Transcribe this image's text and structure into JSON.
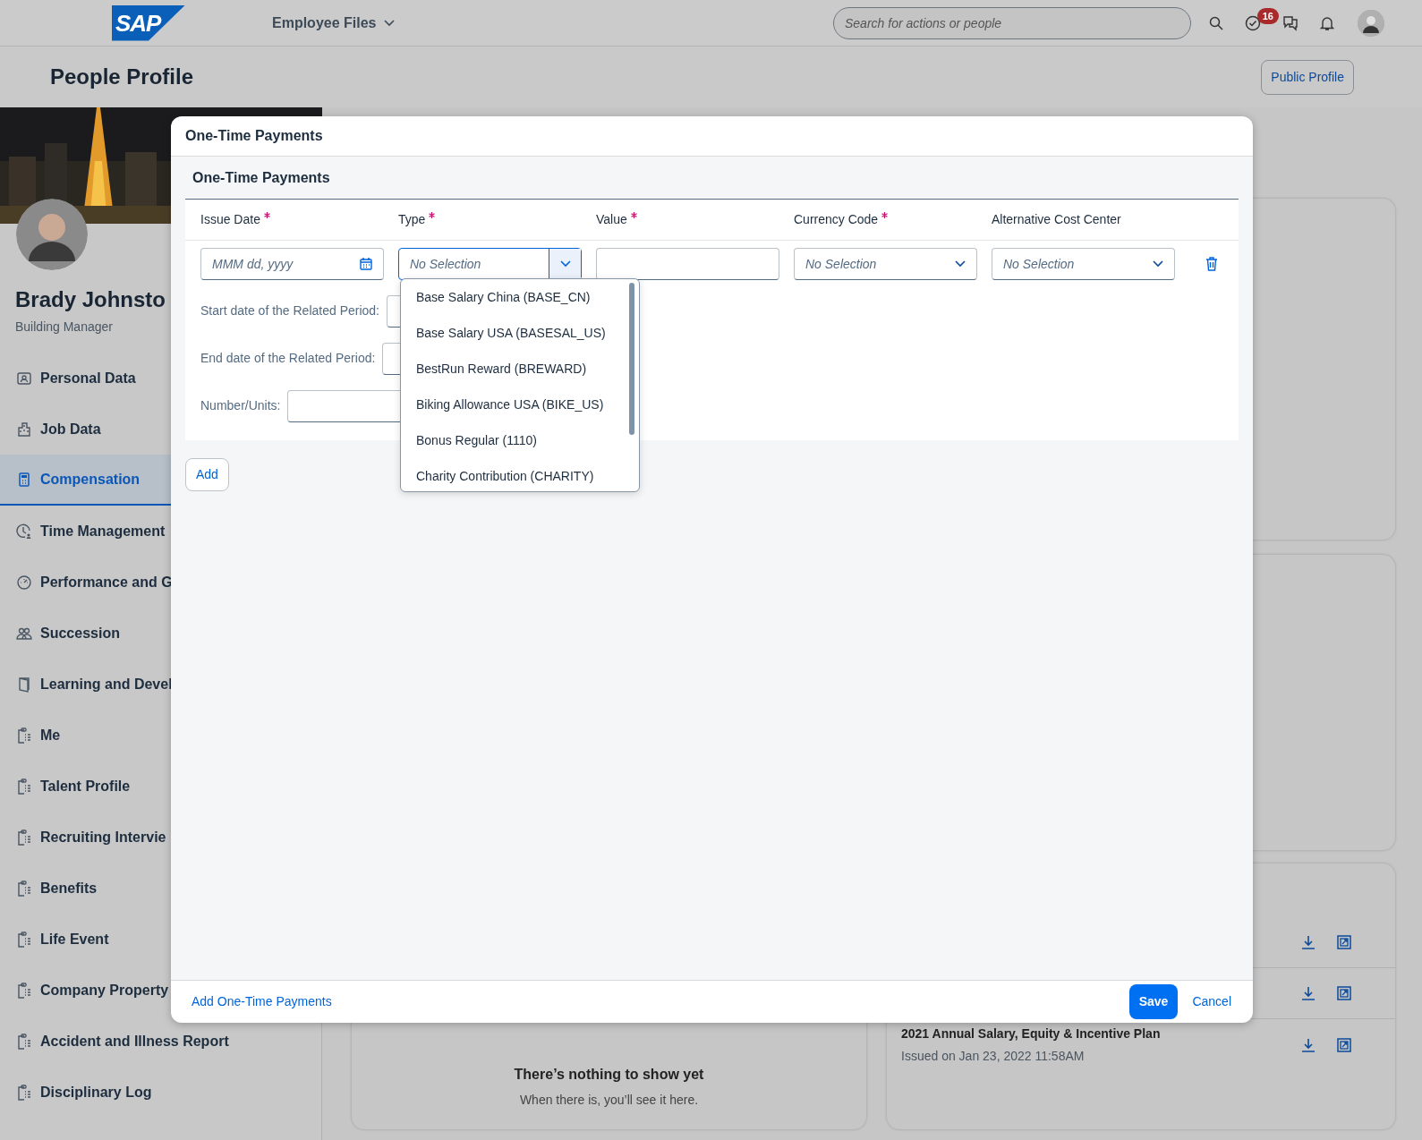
{
  "header": {
    "logo": "SAP",
    "app_title": "Employee Files",
    "search": {
      "placeholder": "Search for actions or people"
    },
    "notification_count": "16"
  },
  "page": {
    "title": "People Profile",
    "public_profile_button": "Public Profile"
  },
  "profile": {
    "name": "Brady Johnsto",
    "job_title": "Building Manager"
  },
  "sidebar": {
    "items": [
      {
        "label": "Personal Data",
        "kind": "contact",
        "selected": false
      },
      {
        "label": "Job Data",
        "kind": "building",
        "selected": false
      },
      {
        "label": "Compensation",
        "kind": "calculator",
        "selected": true
      },
      {
        "label": "Time Management",
        "kind": "clock",
        "selected": false
      },
      {
        "label": "Performance and G",
        "kind": "gauge",
        "selected": false
      },
      {
        "label": "Succession",
        "kind": "people",
        "selected": false
      },
      {
        "label": "Learning and Devel",
        "kind": "book",
        "selected": false
      },
      {
        "label": "Me",
        "kind": "clipboard",
        "selected": false
      },
      {
        "label": "Talent Profile",
        "kind": "clipboard",
        "selected": false
      },
      {
        "label": "Recruiting Intervie",
        "kind": "clipboard",
        "selected": false
      },
      {
        "label": "Benefits",
        "kind": "clipboard",
        "selected": false
      },
      {
        "label": "Life Event",
        "kind": "clipboard",
        "selected": false
      },
      {
        "label": "Company Property",
        "kind": "clipboard",
        "selected": false
      },
      {
        "label": "Accident and Illness Report",
        "kind": "clipboard",
        "selected": false
      },
      {
        "label": "Disciplinary Log",
        "kind": "clipboard",
        "selected": false
      }
    ]
  },
  "background_cards": {
    "empty_state": {
      "title": "There’s nothing to show yet",
      "text": "When there is, you’ll see it here."
    },
    "documents": [
      {
        "kind": "covered"
      },
      {
        "kind": "covered"
      },
      {
        "kind": "item",
        "title": "2021 Annual Salary, Equity & Incentive Plan",
        "issued": "Issued on Jan 23, 2022 11:58AM"
      }
    ]
  },
  "dialog": {
    "title": "One-Time Payments",
    "section_title": "One-Time Payments",
    "columns": [
      {
        "label": "Issue Date",
        "required": true
      },
      {
        "label": "Type",
        "required": true
      },
      {
        "label": "Value",
        "required": true
      },
      {
        "label": "Currency Code",
        "required": true
      },
      {
        "label": "Alternative Cost Center",
        "required": false
      }
    ],
    "row": {
      "issue_date": {
        "placeholder": "MMM dd, yyyy"
      },
      "type": {
        "placeholder": "No Selection",
        "expanded": true,
        "options": [
          "Base Salary China (BASE_CN)",
          "Base Salary USA (BASESAL_US)",
          "BestRun Reward (BREWARD)",
          "Biking Allowance USA (BIKE_US)",
          "Bonus Regular (1110)",
          "Charity Contribution (CHARITY)"
        ]
      },
      "currency": {
        "placeholder": "No Selection"
      },
      "alt_cost_center": {
        "placeholder": "No Selection"
      }
    },
    "extra_fields": [
      {
        "label": "Start date of the Related Period:"
      },
      {
        "label": "End date of the Related Period:"
      },
      {
        "label": "Number/Units:"
      }
    ],
    "add_button": "Add",
    "footer_link": "Add One-Time Payments",
    "save_button": "Save",
    "cancel_button": "Cancel"
  }
}
